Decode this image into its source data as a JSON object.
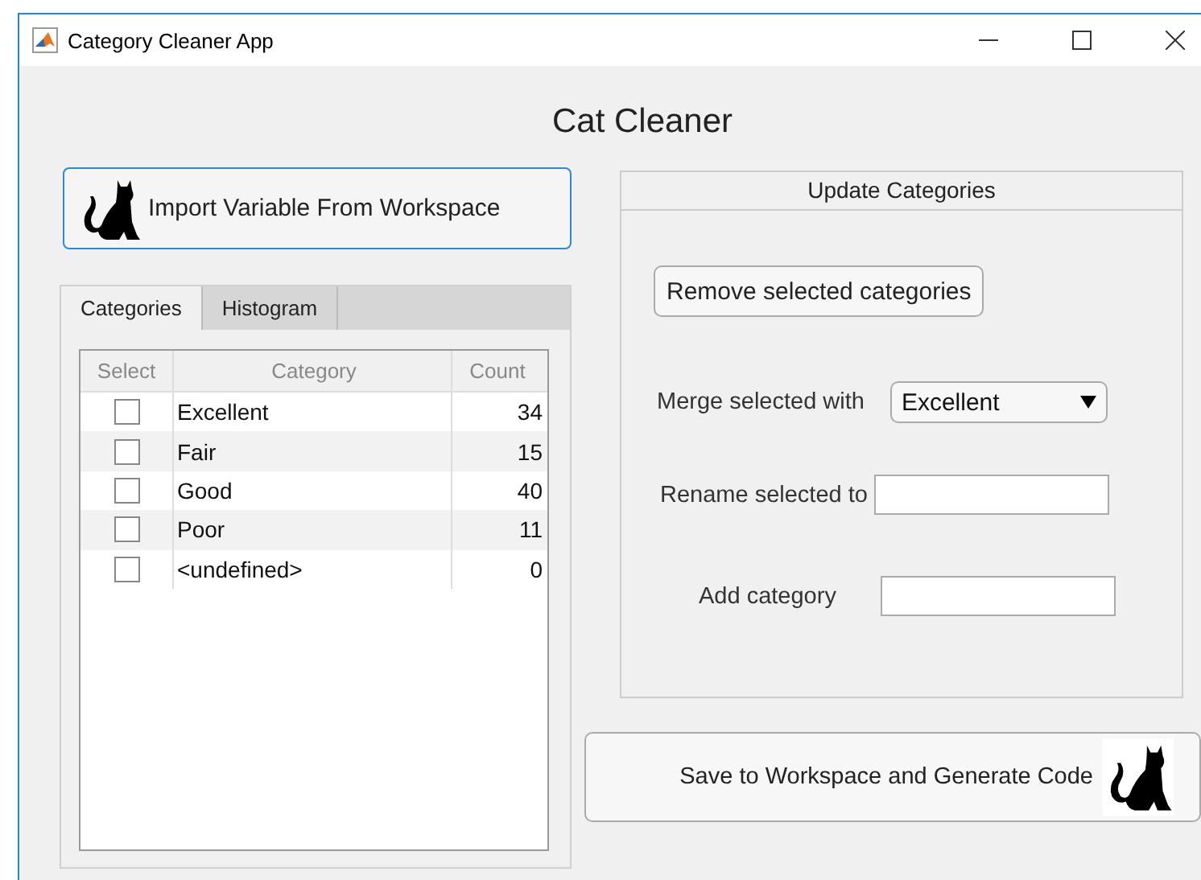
{
  "window": {
    "title": "Category Cleaner App"
  },
  "heading": "Cat Cleaner",
  "import_button": {
    "label": "Import Variable From Workspace"
  },
  "tabs": [
    {
      "label": "Categories",
      "selected": true
    },
    {
      "label": "Histogram",
      "selected": false
    }
  ],
  "table": {
    "columns": [
      "Select",
      "Category",
      "Count"
    ],
    "rows": [
      {
        "checked": false,
        "category": "Excellent",
        "count": "34"
      },
      {
        "checked": false,
        "category": "Fair",
        "count": "15"
      },
      {
        "checked": false,
        "category": "Good",
        "count": "40"
      },
      {
        "checked": false,
        "category": "Poor",
        "count": "11"
      },
      {
        "checked": false,
        "category": "<undefined>",
        "count": "0"
      }
    ]
  },
  "update_panel": {
    "title": "Update Categories",
    "remove_button": "Remove selected categories",
    "merge_label": "Merge selected with",
    "merge_value": "Excellent",
    "rename_label": "Rename selected to",
    "add_label": "Add category"
  },
  "save_button": {
    "label": "Save to Workspace and Generate Code"
  }
}
